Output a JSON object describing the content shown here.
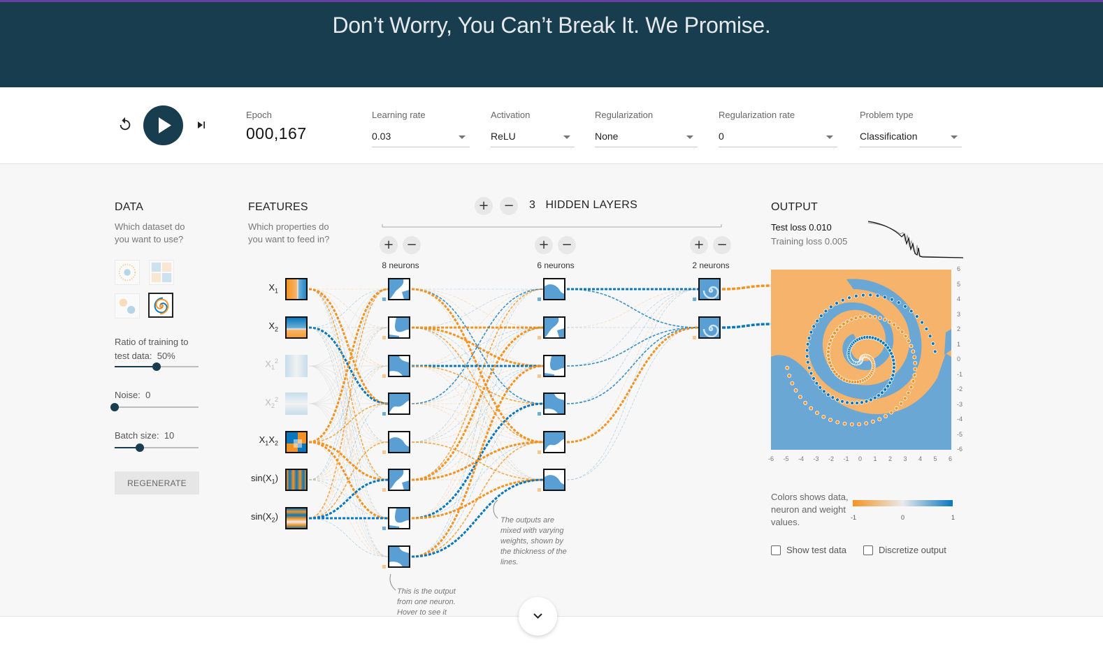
{
  "header": {
    "tagline": "Don’t Worry, You Can’t Break It. We Promise."
  },
  "controls": {
    "epoch_label": "Epoch",
    "epoch_value": "000,167",
    "learning_rate": {
      "label": "Learning rate",
      "value": "0.03"
    },
    "activation": {
      "label": "Activation",
      "value": "ReLU"
    },
    "regularization": {
      "label": "Regularization",
      "value": "None"
    },
    "regularization_rate": {
      "label": "Regularization rate",
      "value": "0"
    },
    "problem_type": {
      "label": "Problem type",
      "value": "Classification"
    }
  },
  "data_panel": {
    "title": "DATA",
    "subtitle": "Which dataset do you want to use?",
    "datasets": [
      "circle",
      "xor",
      "gaussian",
      "spiral"
    ],
    "selected_dataset": "spiral",
    "ratio_label": "Ratio of training to test data:",
    "ratio_value": "50%",
    "ratio_fraction": 0.5,
    "noise_label": "Noise:",
    "noise_value": "0",
    "noise_fraction": 0.0,
    "batch_label": "Batch size:",
    "batch_value": "10",
    "batch_fraction": 0.3,
    "regenerate_label": "REGENERATE"
  },
  "features_panel": {
    "title": "FEATURES",
    "subtitle": "Which properties do you want to feed in?",
    "features": [
      {
        "name": "X1",
        "base": "X",
        "sub": "1",
        "sup": "",
        "active": true
      },
      {
        "name": "X2",
        "base": "X",
        "sub": "2",
        "sup": "",
        "active": true
      },
      {
        "name": "X1 squared",
        "base": "X",
        "sub": "1",
        "sup": "2",
        "active": false
      },
      {
        "name": "X2 squared",
        "base": "X",
        "sub": "2",
        "sup": "2",
        "active": false
      },
      {
        "name": "X1X2",
        "base": "X1X2",
        "sub": "",
        "sup": "",
        "active": true
      },
      {
        "name": "sin(X1)",
        "base": "sin(X1)",
        "sub": "",
        "sup": "",
        "active": true
      },
      {
        "name": "sin(X2)",
        "base": "sin(X2)",
        "sub": "",
        "sup": "",
        "active": true
      }
    ]
  },
  "network": {
    "hidden_layers_count": "3",
    "hidden_layers_label": "HIDDEN LAYERS",
    "layers": [
      {
        "neurons": 8,
        "label": "8 neurons"
      },
      {
        "neurons": 6,
        "label": "6 neurons"
      },
      {
        "neurons": 2,
        "label": "2 neurons"
      }
    ],
    "note_weights": "The outputs are mixed with varying weights, shown by the thickness of the lines.",
    "note_neuron": "This is the output from one neuron. Hover to see it larger."
  },
  "output_panel": {
    "title": "OUTPUT",
    "test_loss_label": "Test loss",
    "test_loss_value": "0.010",
    "training_loss_label": "Training loss",
    "training_loss_value": "0.005",
    "axis_ticks": [
      "-6",
      "-5",
      "-4",
      "-3",
      "-2",
      "-1",
      "0",
      "1",
      "2",
      "3",
      "4",
      "5",
      "6"
    ],
    "legend_text": "Colors shows data, neuron and weight values.",
    "legend_ticks": [
      "-1",
      "0",
      "1"
    ],
    "show_test_data_label": "Show test data",
    "discretize_label": "Discretize output"
  },
  "colors": {
    "orange": "#f59322",
    "blue": "#0877bd",
    "header_bg": "#183d4e"
  }
}
